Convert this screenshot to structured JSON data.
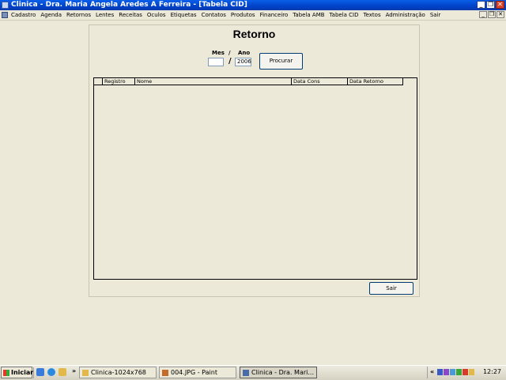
{
  "window": {
    "title": "Clinica - Dra. Maria Angela Aredes A Ferreira - [Tabela CID]",
    "buttons": {
      "minimize": "_",
      "maximize": "❐",
      "close": "✕"
    }
  },
  "menu": {
    "items": [
      "Cadastro",
      "Agenda",
      "Retornos",
      "Lentes",
      "Receitas",
      "Oculos",
      "Etiquetas",
      "Contatos",
      "Produtos",
      "Financeiro",
      "Tabela AMB",
      "Tabela CID",
      "Textos",
      "Administração",
      "Sair"
    ],
    "mdi_buttons": {
      "minimize": "_",
      "restore": "❐",
      "close": "✕"
    }
  },
  "form": {
    "title": "Retorno",
    "mes_label": "Mes",
    "ano_label": "Ano",
    "slash": "/",
    "mes_value": "",
    "ano_value": "2006",
    "procurar_label": "Procurar",
    "sair_label": "Sair"
  },
  "grid": {
    "columns": [
      "",
      "Registro",
      "Nome",
      "Data Cons",
      "Data Retorno"
    ]
  },
  "taskbar": {
    "start_label": "Iniciar",
    "overflow": "»",
    "tasks": [
      {
        "label": "Clinica-1024x768",
        "active": false
      },
      {
        "label": "004.JPG - Paint",
        "active": false
      },
      {
        "label": "Clinica - Dra. Mari...",
        "active": true
      }
    ],
    "tray_expand": "«",
    "clock": "12:27"
  },
  "colors": {
    "titlebar": "#0A5FE8",
    "background": "#ECE9D8"
  }
}
